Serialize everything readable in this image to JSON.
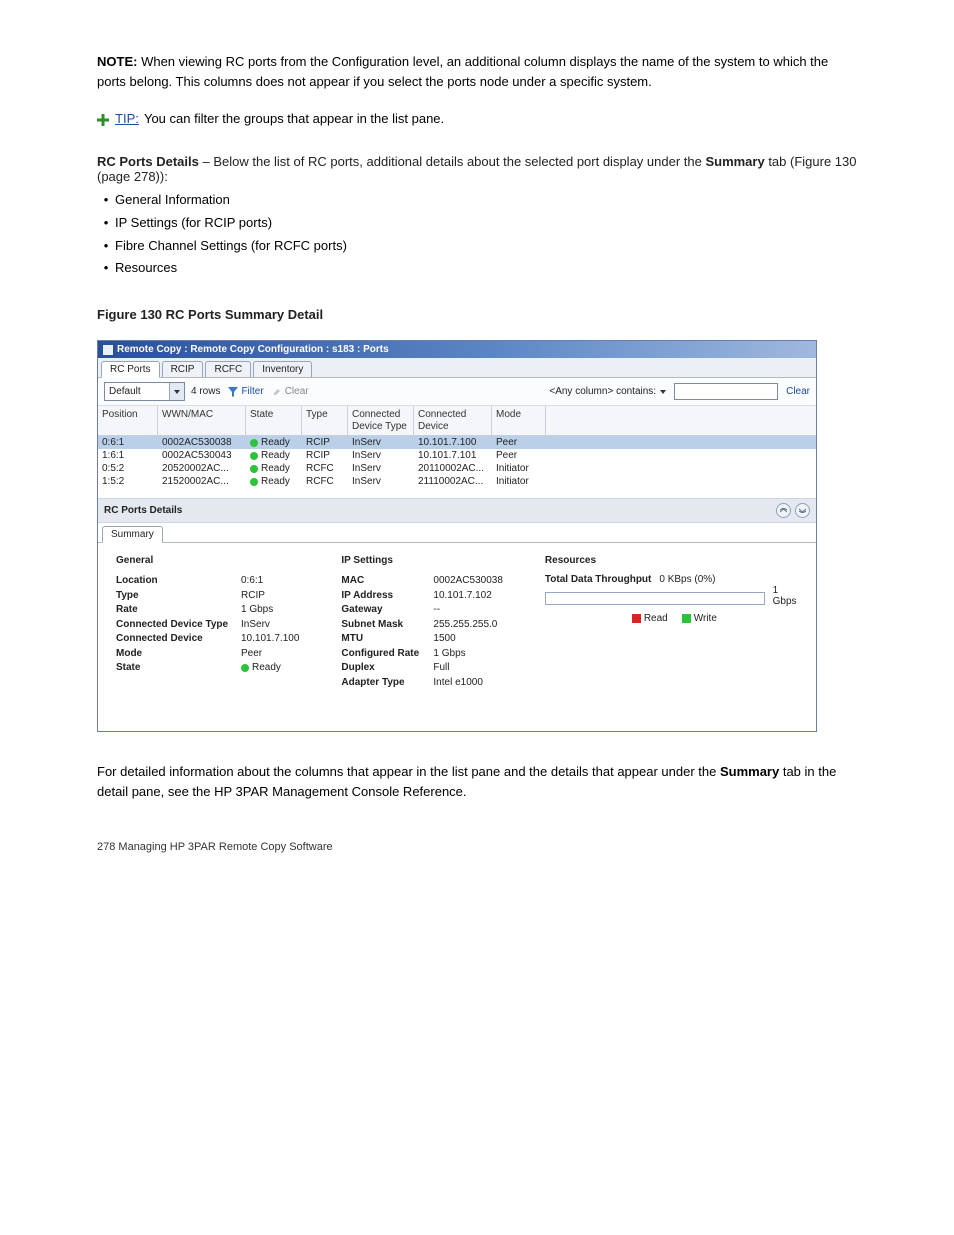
{
  "doc": {
    "intro_lead": "NOTE:",
    "intro_text": " When viewing RC ports from the Configuration level, an additional column displays the name of the system to which the ports belong. This columns does not appear if you select the ports node under a specific system.",
    "tip_label": "TIP:",
    "tip_text": " You can filter the groups that appear in the list pane.",
    "sect_lead": "RC Ports Details",
    "sect_text": " – Below the list of RC ports, additional details about the selected port display under the ",
    "sect_tab": "Summary",
    "sect_text2": " tab ",
    "fig_ref": "(Figure 130 (page 278))",
    "sect_text3": ":",
    "bullets": [
      "General Information",
      "IP Settings (for RCIP ports)",
      "Fibre Channel Settings (for RCFC ports)",
      "Resources"
    ],
    "fig_caption": "Figure 130 RC Ports Summary Detail",
    "footer1": "For detailed information about the columns that appear in the list pane and the details that appear under the ",
    "footer_tab": "Summary",
    "footer2": " tab in the detail pane, see the HP 3PAR Management Console Reference.",
    "pgnum": "278 Managing HP 3PAR Remote Copy Software"
  },
  "win": {
    "title": "Remote Copy : Remote Copy Configuration : s183 : Ports",
    "tabs": [
      "RC Ports",
      "RCIP",
      "RCFC",
      "Inventory"
    ],
    "combo": "Default",
    "rows_text": "4 rows",
    "filter": "Filter",
    "clear": "Clear",
    "search_lbl": "<Any column> contains:",
    "clear2": "Clear",
    "cols": {
      "pos": "Position",
      "wwn": "WWN/MAC",
      "state": "State",
      "type": "Type",
      "cdt": "Connected\nDevice Type",
      "cd": "Connected\nDevice",
      "mode": "Mode"
    },
    "rows": [
      {
        "pos": "0:6:1",
        "wwn": "0002AC530038",
        "state": "Ready",
        "type": "RCIP",
        "cdt": "InServ",
        "cd": "10.101.7.100",
        "mode": "Peer"
      },
      {
        "pos": "1:6:1",
        "wwn": "0002AC530043",
        "state": "Ready",
        "type": "RCIP",
        "cdt": "InServ",
        "cd": "10.101.7.101",
        "mode": "Peer"
      },
      {
        "pos": "0:5:2",
        "wwn": "20520002AC...",
        "state": "Ready",
        "type": "RCFC",
        "cdt": "InServ",
        "cd": "20110002AC...",
        "mode": "Initiator"
      },
      {
        "pos": "1:5:2",
        "wwn": "21520002AC...",
        "state": "Ready",
        "type": "RCFC",
        "cdt": "InServ",
        "cd": "21110002AC...",
        "mode": "Initiator"
      }
    ],
    "details_title": "RC Ports Details",
    "sub_tab": "Summary",
    "general": {
      "head": "General",
      "rows": [
        {
          "l": "Location",
          "v": "0:6:1"
        },
        {
          "l": "Type",
          "v": "RCIP"
        },
        {
          "l": "Rate",
          "v": "1 Gbps"
        },
        {
          "l": "Connected Device Type",
          "v": "InServ"
        },
        {
          "l": "Connected Device",
          "v": "10.101.7.100"
        },
        {
          "l": "Mode",
          "v": "Peer"
        },
        {
          "l": "State",
          "v": "Ready",
          "dot": true
        }
      ]
    },
    "ip": {
      "head": "IP Settings",
      "rows": [
        {
          "l": "MAC",
          "v": "0002AC530038"
        },
        {
          "l": "IP Address",
          "v": "10.101.7.102"
        },
        {
          "l": "Gateway",
          "v": "--"
        },
        {
          "l": "Subnet Mask",
          "v": "255.255.255.0"
        },
        {
          "l": "MTU",
          "v": "1500"
        },
        {
          "l": "Configured Rate",
          "v": "1 Gbps"
        },
        {
          "l": "Duplex",
          "v": "Full"
        },
        {
          "l": "Adapter Type",
          "v": "Intel e1000"
        }
      ]
    },
    "res": {
      "head": "Resources",
      "thru_lbl": "Total Data Throughput",
      "thru_val": "0 KBps (0%)",
      "gauge_max": "1 Gbps",
      "read": "Read",
      "write": "Write"
    }
  }
}
